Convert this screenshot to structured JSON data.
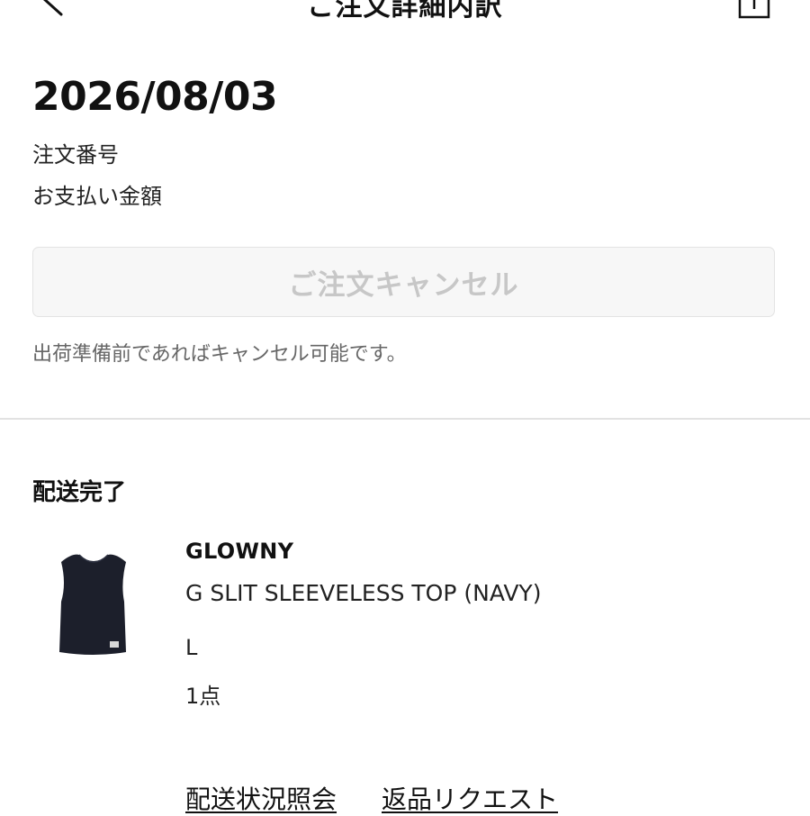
{
  "header": {
    "title": "ご注文詳細内訳",
    "back_icon": "chevron-left-icon",
    "share_icon": "share-icon"
  },
  "order": {
    "date": "2026/08/03",
    "order_number_label": "注文番号",
    "payment_label": "お支払い金額"
  },
  "cancel": {
    "button_label": "ご注文キャンセル",
    "note": "出荷準備前であればキャンセル可能です。"
  },
  "shipment": {
    "status": "配送完了",
    "item": {
      "image_icon": "sleeveless-top-thumbnail",
      "brand": "GLOWNY",
      "name": "G SLIT SLEEVELESS TOP (NAVY)",
      "size": "L",
      "quantity": "1点"
    },
    "links": {
      "tracking": "配送状況照会",
      "return": "返品リクエスト"
    }
  },
  "colors": {
    "text": "#111111",
    "muted": "#666666",
    "disabled_text": "#c7c7c7",
    "button_bg": "#f7f7f7",
    "product_navy": "#1c1f2b"
  }
}
